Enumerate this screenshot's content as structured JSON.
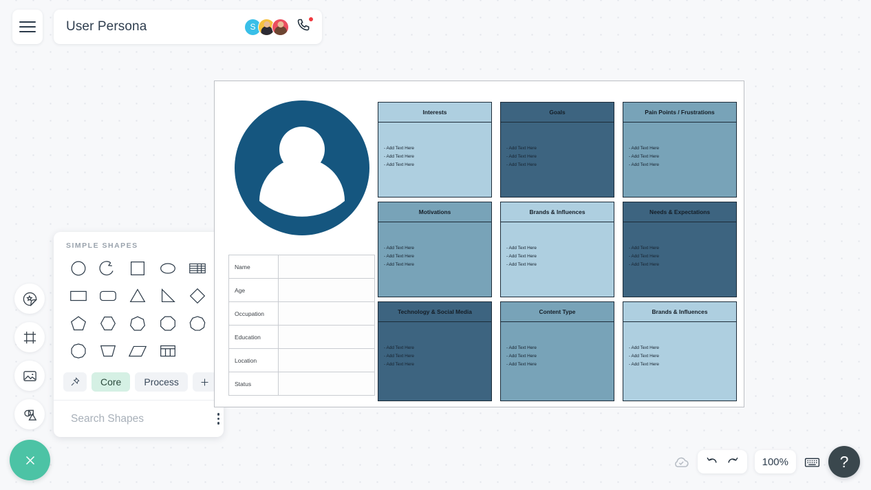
{
  "header": {
    "menu_icon": "hamburger-menu-icon",
    "title": "User Persona",
    "avatars": [
      {
        "initial": "S",
        "color": "#39bfe8",
        "name": "avatar-s"
      },
      {
        "initial": "",
        "color": "#f7c03e",
        "name": "avatar-user-2"
      },
      {
        "initial": "",
        "color": "#eb4e5f",
        "name": "avatar-user-3"
      }
    ],
    "call_icon": "phone-icon",
    "call_badge_color": "#f0393f"
  },
  "left_toolbar": {
    "items": [
      {
        "icon": "sticker-star-icon",
        "name": "sticker-tool"
      },
      {
        "icon": "frame-icon",
        "name": "frame-tool"
      },
      {
        "icon": "image-icon",
        "name": "image-tool"
      },
      {
        "icon": "shapes-icon",
        "name": "shapes-tool"
      }
    ],
    "close_icon": "close-x-icon",
    "close_color": "#4cc3a5"
  },
  "shapes_panel": {
    "section_title": "SIMPLE SHAPES",
    "shapes": [
      "circle",
      "arc",
      "square",
      "ellipse",
      "table-striped",
      "rectangle",
      "rounded-rectangle",
      "triangle",
      "right-triangle",
      "diamond",
      "pentagon",
      "hexagon",
      "heptagon",
      "octagon",
      "nonagon",
      "decagon",
      "trapezoid",
      "parallelogram",
      "table-grid"
    ],
    "tabs": [
      {
        "label": "",
        "icon": "pin-icon",
        "active": false,
        "name": "tab-pinned"
      },
      {
        "label": "Core",
        "active": true,
        "name": "tab-core"
      },
      {
        "label": "Process",
        "active": false,
        "name": "tab-process"
      },
      {
        "label": "+",
        "active": false,
        "name": "tab-add"
      }
    ],
    "search_placeholder": "Search Shapes",
    "search_value": "",
    "search_icon": "search-icon",
    "menu_icon": "kebab-menu-icon"
  },
  "canvas": {
    "persona_avatar_icon": "user-avatar-placeholder",
    "persona_avatar_color": "#15567f",
    "info_table": {
      "rows": [
        {
          "label": "Name",
          "value": ""
        },
        {
          "label": "Age",
          "value": ""
        },
        {
          "label": "Occupation",
          "value": ""
        },
        {
          "label": "Education",
          "value": ""
        },
        {
          "label": "Location",
          "value": ""
        },
        {
          "label": "Status",
          "value": ""
        }
      ]
    },
    "bullet_text": "- Add Text Here",
    "palette": {
      "light": "#aecfe0",
      "medium": "#78a3b8",
      "dark": "#3d6480",
      "border": "#1c2b38"
    },
    "cards": [
      {
        "title": "Interests",
        "tone": "light",
        "head_tone": "light",
        "bullets": [
          "- Add Text Here",
          "- Add Text Here",
          "- Add Text Here"
        ]
      },
      {
        "title": "Goals",
        "tone": "dark",
        "head_tone": "dark",
        "bullets": [
          "- Add Text Here",
          "- Add Text Here",
          "- Add Text Here"
        ]
      },
      {
        "title": "Pain Points / Frustrations",
        "tone": "medium",
        "head_tone": "medium",
        "bullets": [
          "- Add Text Here",
          "- Add Text Here",
          "- Add Text Here"
        ]
      },
      {
        "title": "Motivations",
        "tone": "medium",
        "head_tone": "medium",
        "bullets": [
          "- Add Text Here",
          "- Add Text Here",
          "- Add Text Here"
        ]
      },
      {
        "title": "Brands & Influences",
        "tone": "light",
        "head_tone": "light",
        "bullets": [
          "- Add Text Here",
          "- Add Text Here",
          "- Add Text Here"
        ]
      },
      {
        "title": "Needs & Expectations",
        "tone": "dark",
        "head_tone": "dark",
        "bullets": [
          "- Add Text Here",
          "- Add Text Here",
          "- Add Text Here"
        ]
      },
      {
        "title": "Technology & Social Media",
        "tone": "dark",
        "head_tone": "dark",
        "bullets": [
          "- Add Text Here",
          "- Add Text Here",
          "- Add Text Here"
        ]
      },
      {
        "title": "Content Type",
        "tone": "medium",
        "head_tone": "medium",
        "bullets": [
          "- Add Text Here",
          "- Add Text Here",
          "- Add Text Here"
        ]
      },
      {
        "title": "Brands & Influences",
        "tone": "light",
        "head_tone": "light",
        "bullets": [
          "- Add Text Here",
          "- Add Text Here",
          "- Add Text Here"
        ]
      }
    ]
  },
  "bottom_bar": {
    "save_icon": "cloud-check-icon",
    "undo_icon": "undo-arrow-icon",
    "redo_icon": "redo-arrow-icon",
    "zoom_level": "100%",
    "keyboard_icon": "keyboard-icon",
    "help_label": "?"
  }
}
